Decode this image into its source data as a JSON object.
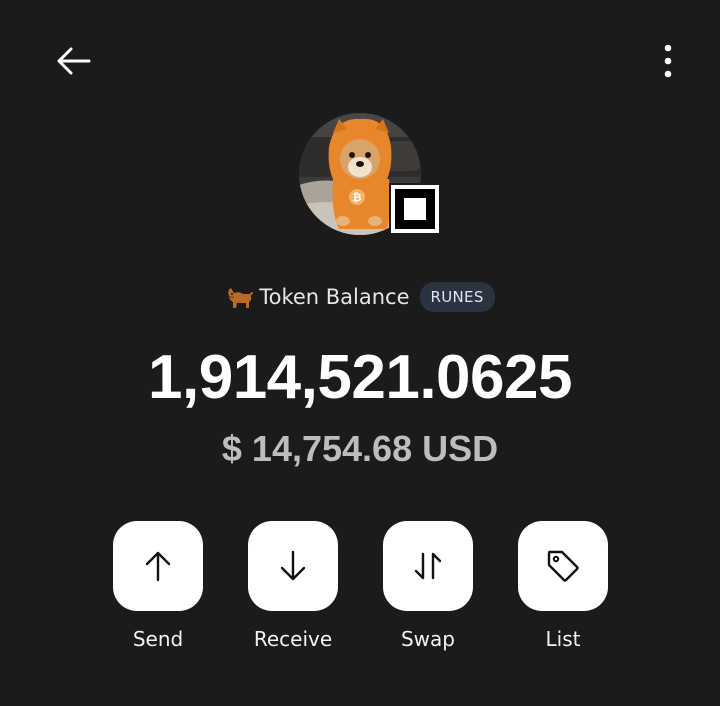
{
  "header": {
    "back_icon": "arrow-left-icon",
    "more_icon": "more-vertical-icon"
  },
  "token": {
    "avatar_icon": "dog-in-orange-hoodie-avatar",
    "badge_icon": "runes-square-icon",
    "emoji_icon": "dog-icon",
    "name": "Token Balance",
    "protocol_tag": "RUNES",
    "amount": "1,914,521.0625",
    "fiat_value": "$ 14,754.68 USD"
  },
  "actions": [
    {
      "label": "Send",
      "icon": "arrow-up-icon"
    },
    {
      "label": "Receive",
      "icon": "arrow-down-icon"
    },
    {
      "label": "Swap",
      "icon": "swap-arrows-icon"
    },
    {
      "label": "List",
      "icon": "tag-icon"
    }
  ],
  "colors": {
    "background": "#1b1b1b",
    "button_bg": "#ffffff",
    "tag_bg": "#2c3340",
    "fiat_text": "#bdbdbd",
    "avatar_hoodie": "#e8862c"
  }
}
